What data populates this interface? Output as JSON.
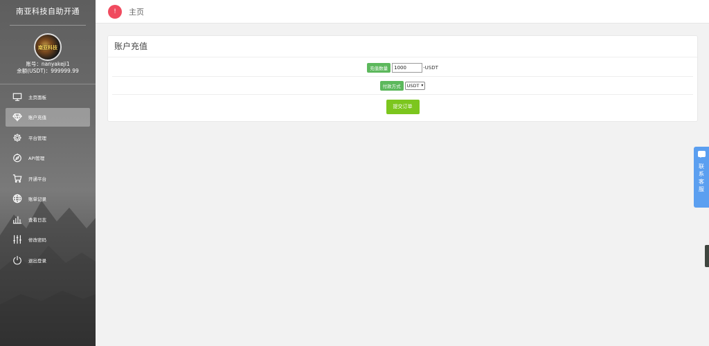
{
  "sidebar": {
    "brand": "南亚科技自助开通",
    "avatar_text": "南亚科技",
    "account_line": "账号：nanyakeji1",
    "balance_line": "余额(USDT)：999999.99",
    "items": [
      {
        "label": "主页面板",
        "icon": "monitor-icon"
      },
      {
        "label": "账户充值",
        "icon": "diamond-icon",
        "active": true
      },
      {
        "label": "平台管理",
        "icon": "gear-icon"
      },
      {
        "label": "API管理",
        "icon": "compass-icon"
      },
      {
        "label": "开通平台",
        "icon": "cart-icon"
      },
      {
        "label": "账单记录",
        "icon": "globe-icon"
      },
      {
        "label": "查看日志",
        "icon": "bar-chart-icon"
      },
      {
        "label": "修改密码",
        "icon": "sliders-icon"
      },
      {
        "label": "退出登录",
        "icon": "power-icon"
      }
    ]
  },
  "topbar": {
    "badge": "!",
    "breadcrumb": "主页"
  },
  "recharge": {
    "title": "账户充值",
    "amount_label": "充值数量",
    "amount_value": "1000",
    "amount_unit": "-USDT",
    "method_label": "付款方式",
    "method_value": "USDT",
    "submit_label": "提交订单"
  },
  "support": {
    "label": "联系客服"
  },
  "colors": {
    "accent_green": "#5cb85c",
    "submit_green": "#7cc61e",
    "badge_red": "#f04b5f",
    "support_blue": "#5b9ff0"
  }
}
